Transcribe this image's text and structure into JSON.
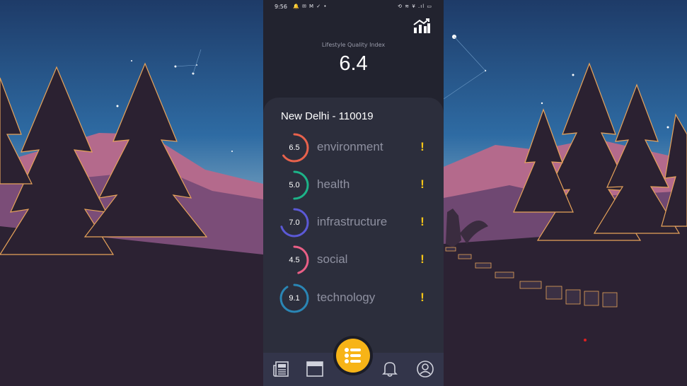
{
  "status_bar": {
    "time": "9:56",
    "left_icons": "🔔 ✉ M ✓ •",
    "right_icons": "⟲ ≋ ¥ .ıl ▭"
  },
  "header": {
    "index_label": "Lifestyle Quality Index",
    "index_value": "6.4"
  },
  "location": "New Delhi - 110019",
  "metrics": [
    {
      "score": "6.5",
      "name": "environment",
      "alert": "!",
      "color": "#e8624c",
      "fraction": 0.65
    },
    {
      "score": "5.0",
      "name": "health",
      "alert": "!",
      "color": "#1db388",
      "fraction": 0.5
    },
    {
      "score": "7.0",
      "name": "infrastructure",
      "alert": "!",
      "color": "#5b59d6",
      "fraction": 0.7
    },
    {
      "score": "4.5",
      "name": "social",
      "alert": "!",
      "color": "#ea5f86",
      "fraction": 0.45
    },
    {
      "score": "9.1",
      "name": "technology",
      "alert": "!",
      "color": "#2a86b5",
      "fraction": 0.91
    }
  ],
  "colors": {
    "accent": "#f7b417",
    "phone_background": "#22232f",
    "card_background": "#2c2e3c",
    "alert": "#f5c518"
  },
  "icons": {
    "stats": "bar-chart-trend-icon",
    "nav": [
      "newspaper-icon",
      "browser-window-icon",
      "checklist-icon",
      "bell-icon",
      "profile-icon"
    ]
  }
}
